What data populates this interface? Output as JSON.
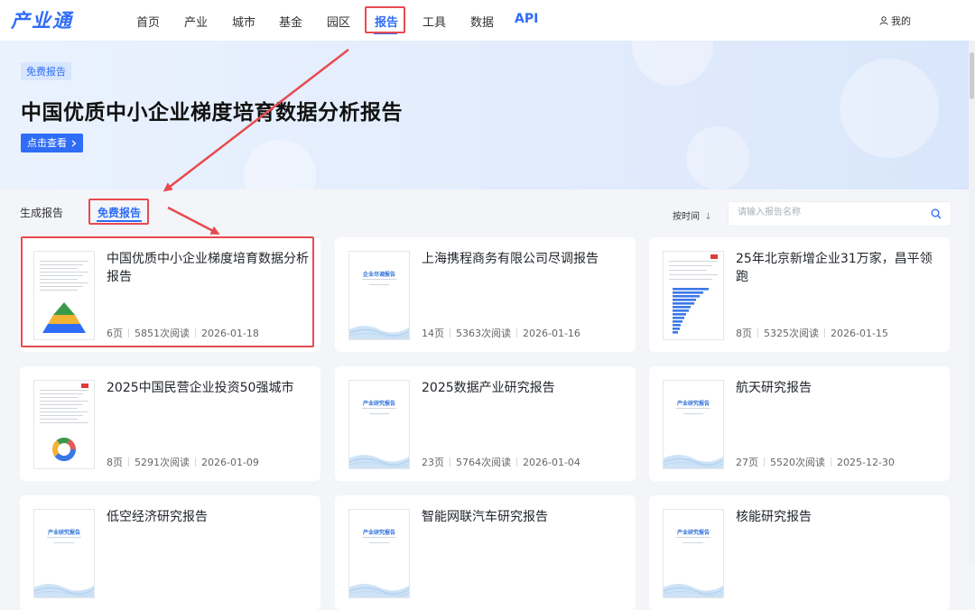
{
  "nav": {
    "logo": "产业通",
    "items": [
      "首页",
      "产业",
      "城市",
      "基金",
      "园区",
      "报告",
      "工具",
      "数据"
    ],
    "api": "API",
    "active_index": 5,
    "user": "我的"
  },
  "banner": {
    "tag": "免费报告",
    "title": "中国优质中小企业梯度培育数据分析报告",
    "button": "点击查看"
  },
  "tabs": [
    "生成报告",
    "免费报告"
  ],
  "sort_label": "按时间",
  "sort_arrow": "↓",
  "search": {
    "placeholder": "请输入报告名称"
  },
  "colors": {
    "accent": "#2f6df6",
    "annotation": "#e84a4f"
  },
  "thumb_heads": {
    "diligence": "企业尽调报告",
    "research": "产业研究报告"
  },
  "cards": [
    {
      "title": "中国优质中小企业梯度培育数据分析报告",
      "pages": "6页",
      "reads": "5851次阅读",
      "date": "2026-01-18",
      "thumb": "pyramid"
    },
    {
      "title": "上海携程商务有限公司尽调报告",
      "pages": "14页",
      "reads": "5363次阅读",
      "date": "2026-01-16",
      "thumb": "diligence"
    },
    {
      "title": "25年北京新增企业31万家，昌平领跑",
      "pages": "8页",
      "reads": "5325次阅读",
      "date": "2026-01-15",
      "thumb": "barchart"
    },
    {
      "title": "2025中国民营企业投资50强城市",
      "pages": "8页",
      "reads": "5291次阅读",
      "date": "2026-01-09",
      "thumb": "donut"
    },
    {
      "title": "2025数据产业研究报告",
      "pages": "23页",
      "reads": "5764次阅读",
      "date": "2026-01-04",
      "thumb": "research"
    },
    {
      "title": "航天研究报告",
      "pages": "27页",
      "reads": "5520次阅读",
      "date": "2025-12-30",
      "thumb": "research"
    },
    {
      "title": "低空经济研究报告",
      "pages": "",
      "reads": "",
      "date": "",
      "thumb": "research"
    },
    {
      "title": "智能网联汽车研究报告",
      "pages": "",
      "reads": "",
      "date": "",
      "thumb": "research"
    },
    {
      "title": "核能研究报告",
      "pages": "",
      "reads": "",
      "date": "",
      "thumb": "research"
    }
  ]
}
